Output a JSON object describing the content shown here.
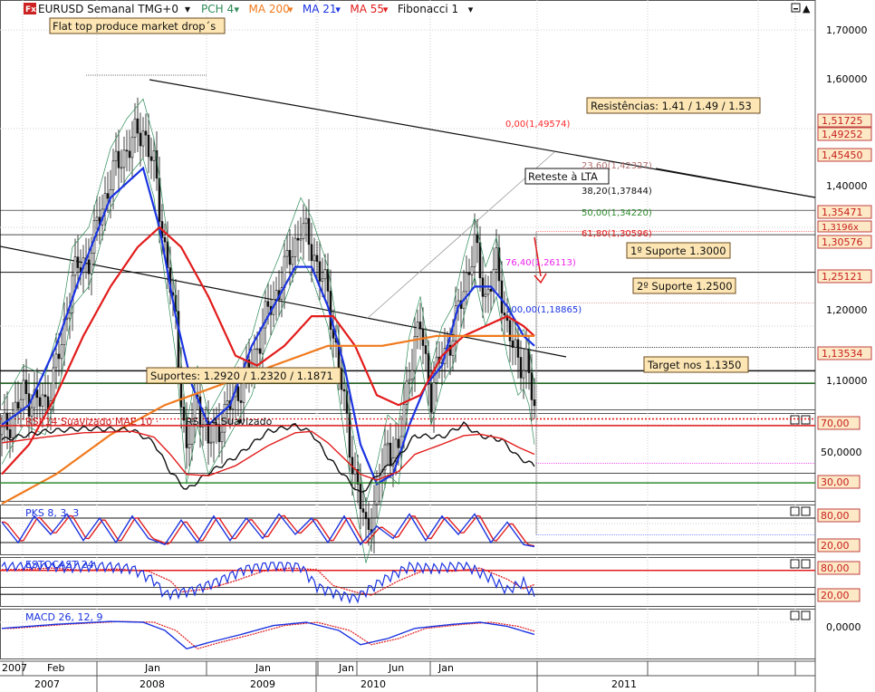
{
  "colors": {
    "background": "#ffffff",
    "grid": "#cfcfcf",
    "price_box_fill": "#fde9c6",
    "label_fill": "#fde6b4",
    "ma21": "#1a33e0",
    "ma55": "#e21c1c",
    "ma200": "#f07a1e",
    "pch": "#2e8b57",
    "fib": "#ff2a2a",
    "candle": "#111111"
  },
  "header": {
    "logo_text": "Fx",
    "title": "EURUSD Semanal TMG+0",
    "legend": [
      {
        "text": "PCH 4",
        "color": "#2e8b57"
      },
      {
        "text": "MA 200",
        "color": "#f07a1e"
      },
      {
        "text": "MA 21",
        "color": "#1a33e0"
      },
      {
        "text": "MA 55",
        "color": "#e21c1c"
      },
      {
        "text": "Fibonacci 1",
        "color": "#111111"
      }
    ],
    "annotation": "Flat top produce market drop´s"
  },
  "annotations": {
    "resistances": "Resistências: 1.41 / 1.49 / 1.53",
    "retest": "Reteste à LTA",
    "support1": "1º Suporte 1.3000",
    "support2": "2º Suporte 1.2500",
    "supports": "Suportes: 1.2920 / 1.2320 / 1.1871",
    "target": "Target nos 1.1350"
  },
  "fibonacci": [
    {
      "label": "0,00(1,49574)",
      "color": "#ff2a2a"
    },
    {
      "label": "23,60(1,42327)",
      "color": "#b07070"
    },
    {
      "label": "38,20(1,37844)",
      "color": "#111111"
    },
    {
      "label": "50,00(1,34220)",
      "color": "#2e8b2e"
    },
    {
      "label": "61,80(1,30596)",
      "color": "#e21c1c"
    },
    {
      "label": "76,40(1,26113)",
      "color": "#ee22ee"
    },
    {
      "label": "100,00(1,18865)",
      "color": "#1a33e0"
    }
  ],
  "price_axis": {
    "ticks": [
      "1,70000",
      "1,60000",
      "1,50000",
      "1,40000",
      "1,30000",
      "1,20000",
      "1,10000"
    ],
    "levels": [
      "1,51725",
      "1,49252",
      "1,45450",
      "1,35471",
      "1,30576",
      "1,25121",
      "1,13534"
    ],
    "partial_label": "1,3196x"
  },
  "chart_data": [
    {
      "type": "line",
      "title": "EURUSD Semanal TMG+0",
      "ylim": [
        1.05,
        1.75
      ],
      "x_axis_years": [
        "2007",
        "2008",
        "2009",
        "2010",
        "2011"
      ],
      "x_axis_months": [
        "2007",
        "Feb",
        "Jan",
        "Jan",
        "Jan",
        "Jun",
        "Jan"
      ],
      "series": [
        {
          "name": "EURUSD",
          "points": [
            [
              0,
              1.29
            ],
            [
              8,
              1.33
            ],
            [
              16,
              1.32
            ],
            [
              22,
              1.38
            ],
            [
              26,
              1.45
            ],
            [
              32,
              1.47
            ],
            [
              40,
              1.55
            ],
            [
              46,
              1.58
            ],
            [
              52,
              1.6
            ],
            [
              56,
              1.56
            ],
            [
              60,
              1.48
            ],
            [
              64,
              1.4
            ],
            [
              68,
              1.27
            ],
            [
              72,
              1.33
            ],
            [
              76,
              1.28
            ],
            [
              80,
              1.3
            ],
            [
              86,
              1.33
            ],
            [
              92,
              1.36
            ],
            [
              96,
              1.4
            ],
            [
              102,
              1.44
            ],
            [
              106,
              1.47
            ],
            [
              110,
              1.5
            ],
            [
              114,
              1.48
            ],
            [
              120,
              1.43
            ],
            [
              124,
              1.36
            ],
            [
              128,
              1.28
            ],
            [
              132,
              1.22
            ],
            [
              134,
              1.19
            ],
            [
              138,
              1.23
            ],
            [
              142,
              1.28
            ],
            [
              146,
              1.27
            ],
            [
              150,
              1.36
            ],
            [
              154,
              1.4
            ],
            [
              158,
              1.33
            ],
            [
              162,
              1.37
            ],
            [
              166,
              1.39
            ],
            [
              170,
              1.44
            ],
            [
              174,
              1.48
            ],
            [
              178,
              1.43
            ],
            [
              182,
              1.46
            ],
            [
              186,
              1.4
            ],
            [
              190,
              1.36
            ],
            [
              193,
              1.37
            ],
            [
              196,
              1.31
            ]
          ]
        },
        {
          "name": "MA 21",
          "points": [
            [
              0,
              1.3
            ],
            [
              10,
              1.32
            ],
            [
              20,
              1.38
            ],
            [
              30,
              1.46
            ],
            [
              40,
              1.53
            ],
            [
              52,
              1.56
            ],
            [
              58,
              1.5
            ],
            [
              64,
              1.41
            ],
            [
              70,
              1.34
            ],
            [
              76,
              1.3
            ],
            [
              84,
              1.32
            ],
            [
              92,
              1.38
            ],
            [
              100,
              1.42
            ],
            [
              108,
              1.46
            ],
            [
              114,
              1.46
            ],
            [
              120,
              1.42
            ],
            [
              126,
              1.36
            ],
            [
              132,
              1.28
            ],
            [
              138,
              1.24
            ],
            [
              144,
              1.25
            ],
            [
              150,
              1.3
            ],
            [
              156,
              1.34
            ],
            [
              162,
              1.36
            ],
            [
              168,
              1.42
            ],
            [
              174,
              1.44
            ],
            [
              180,
              1.44
            ],
            [
              186,
              1.42
            ],
            [
              192,
              1.39
            ],
            [
              196,
              1.38
            ]
          ]
        },
        {
          "name": "MA 55",
          "points": [
            [
              0,
              1.25
            ],
            [
              10,
              1.28
            ],
            [
              20,
              1.33
            ],
            [
              30,
              1.39
            ],
            [
              40,
              1.44
            ],
            [
              50,
              1.48
            ],
            [
              58,
              1.5
            ],
            [
              66,
              1.48
            ],
            [
              76,
              1.43
            ],
            [
              86,
              1.37
            ],
            [
              94,
              1.36
            ],
            [
              104,
              1.38
            ],
            [
              114,
              1.41
            ],
            [
              122,
              1.41
            ],
            [
              130,
              1.38
            ],
            [
              138,
              1.33
            ],
            [
              146,
              1.32
            ],
            [
              154,
              1.33
            ],
            [
              162,
              1.37
            ],
            [
              170,
              1.39
            ],
            [
              178,
              1.4
            ],
            [
              186,
              1.41
            ],
            [
              192,
              1.4
            ],
            [
              196,
              1.39
            ]
          ]
        },
        {
          "name": "MA 200",
          "points": [
            [
              0,
              1.22
            ],
            [
              20,
              1.25
            ],
            [
              40,
              1.29
            ],
            [
              60,
              1.32
            ],
            [
              80,
              1.34
            ],
            [
              100,
              1.36
            ],
            [
              120,
              1.38
            ],
            [
              140,
              1.38
            ],
            [
              160,
              1.39
            ],
            [
              180,
              1.39
            ],
            [
              196,
              1.39
            ]
          ]
        }
      ]
    },
    {
      "type": "line",
      "title": "RSI 14 Suavizado MAE 10 · RSI 14 Suavizado",
      "ylim": [
        20,
        75
      ],
      "ticks": [
        "70,00",
        "50,0000",
        "30,00"
      ],
      "series": [
        {
          "name": "RSI 14 Suavizado",
          "points": [
            [
              0,
              60
            ],
            [
              16,
              66
            ],
            [
              30,
              68
            ],
            [
              48,
              67
            ],
            [
              56,
              58
            ],
            [
              62,
              38
            ],
            [
              68,
              25
            ],
            [
              76,
              37
            ],
            [
              86,
              48
            ],
            [
              98,
              66
            ],
            [
              108,
              70
            ],
            [
              114,
              65
            ],
            [
              120,
              48
            ],
            [
              126,
              35
            ],
            [
              132,
              22
            ],
            [
              138,
              35
            ],
            [
              146,
              48
            ],
            [
              152,
              63
            ],
            [
              162,
              62
            ],
            [
              170,
              71
            ],
            [
              176,
              63
            ],
            [
              184,
              60
            ],
            [
              190,
              48
            ],
            [
              196,
              42
            ]
          ]
        },
        {
          "name": "RSI 14 Suavizado MAE 10",
          "points": [
            [
              0,
              58
            ],
            [
              16,
              62
            ],
            [
              30,
              65
            ],
            [
              48,
              66
            ],
            [
              56,
              62
            ],
            [
              62,
              50
            ],
            [
              68,
              36
            ],
            [
              76,
              35
            ],
            [
              86,
              42
            ],
            [
              98,
              56
            ],
            [
              108,
              65
            ],
            [
              114,
              66
            ],
            [
              120,
              58
            ],
            [
              126,
              47
            ],
            [
              132,
              36
            ],
            [
              138,
              32
            ],
            [
              146,
              38
            ],
            [
              152,
              50
            ],
            [
              162,
              57
            ],
            [
              170,
              63
            ],
            [
              176,
              64
            ],
            [
              184,
              61
            ],
            [
              190,
              55
            ],
            [
              196,
              50
            ]
          ]
        }
      ]
    },
    {
      "type": "line",
      "title": "PKS 8, 3, 3",
      "ylim": [
        0,
        100
      ],
      "ticks": [
        "80,00",
        "20,00"
      ],
      "series": [
        {
          "name": "PKS 8, 3, 3",
          "points": [
            [
              0,
              70
            ],
            [
              6,
              20
            ],
            [
              12,
              85
            ],
            [
              18,
              40
            ],
            [
              24,
              90
            ],
            [
              30,
              25
            ],
            [
              36,
              80
            ],
            [
              42,
              20
            ],
            [
              48,
              85
            ],
            [
              54,
              30
            ],
            [
              60,
              15
            ],
            [
              66,
              75
            ],
            [
              72,
              20
            ],
            [
              78,
              85
            ],
            [
              84,
              25
            ],
            [
              90,
              80
            ],
            [
              96,
              30
            ],
            [
              102,
              90
            ],
            [
              108,
              40
            ],
            [
              114,
              80
            ],
            [
              120,
              20
            ],
            [
              126,
              85
            ],
            [
              132,
              15
            ],
            [
              138,
              60
            ],
            [
              144,
              30
            ],
            [
              150,
              90
            ],
            [
              156,
              25
            ],
            [
              162,
              85
            ],
            [
              168,
              40
            ],
            [
              174,
              90
            ],
            [
              180,
              20
            ],
            [
              186,
              70
            ],
            [
              192,
              15
            ],
            [
              196,
              10
            ]
          ]
        }
      ]
    },
    {
      "type": "line",
      "title": "ESTOCAST 24",
      "ylim": [
        0,
        100
      ],
      "ticks": [
        "80,00",
        "20,00"
      ],
      "series": [
        {
          "name": "ESTOCAST 24",
          "points": [
            [
              0,
              90
            ],
            [
              12,
              95
            ],
            [
              24,
              88
            ],
            [
              36,
              92
            ],
            [
              48,
              85
            ],
            [
              56,
              55
            ],
            [
              60,
              20
            ],
            [
              70,
              30
            ],
            [
              80,
              55
            ],
            [
              90,
              85
            ],
            [
              100,
              95
            ],
            [
              110,
              90
            ],
            [
              116,
              40
            ],
            [
              124,
              20
            ],
            [
              130,
              10
            ],
            [
              140,
              55
            ],
            [
              150,
              90
            ],
            [
              160,
              85
            ],
            [
              170,
              95
            ],
            [
              180,
              60
            ],
            [
              186,
              30
            ],
            [
              192,
              50
            ],
            [
              196,
              15
            ]
          ]
        }
      ]
    },
    {
      "type": "line",
      "title": "MACD 26, 12, 9",
      "ylim": [
        -0.06,
        0.04
      ],
      "ticks": [
        "0,0000"
      ],
      "series": [
        {
          "name": "MACD 26, 12, 9",
          "points": [
            [
              0,
              0.005
            ],
            [
              20,
              0.015
            ],
            [
              40,
              0.022
            ],
            [
              52,
              0.02
            ],
            [
              60,
              0.0
            ],
            [
              68,
              -0.045
            ],
            [
              76,
              -0.03
            ],
            [
              88,
              -0.01
            ],
            [
              100,
              0.012
            ],
            [
              112,
              0.02
            ],
            [
              124,
              0.0
            ],
            [
              132,
              -0.035
            ],
            [
              142,
              -0.02
            ],
            [
              152,
              0.005
            ],
            [
              166,
              0.015
            ],
            [
              176,
              0.02
            ],
            [
              186,
              0.01
            ],
            [
              196,
              -0.01
            ]
          ]
        }
      ]
    }
  ]
}
